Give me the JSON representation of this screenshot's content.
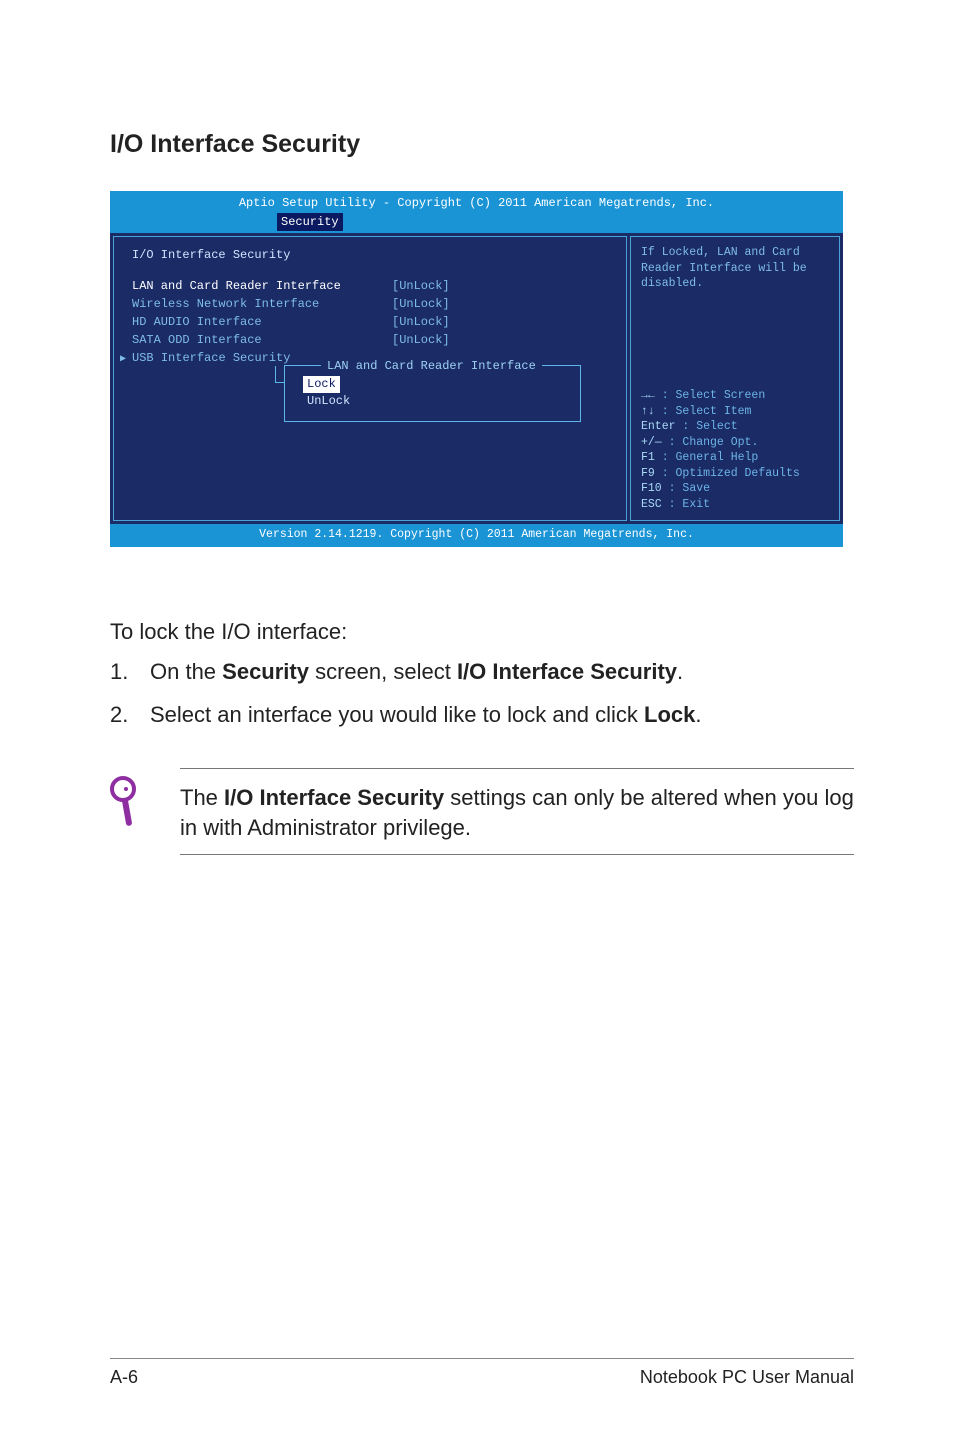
{
  "title": "I/O Interface Security",
  "bios": {
    "header": "Aptio Setup Utility - Copyright (C) 2011 American Megatrends, Inc.",
    "tab": "Security",
    "section_title": "I/O Interface Security",
    "rows": [
      {
        "label": "LAN and Card Reader Interface",
        "value": "[UnLock]",
        "highlight": true
      },
      {
        "label": "Wireless Network Interface",
        "value": "[UnLock]"
      },
      {
        "label": "HD AUDIO Interface",
        "value": "[UnLock]"
      },
      {
        "label": "SATA ODD Interface",
        "value": "[UnLock]"
      },
      {
        "label": "USB Interface Security",
        "value": "",
        "submenu": true
      }
    ],
    "popup": {
      "title": "LAN and Card Reader Interface",
      "options": [
        "Lock",
        "UnLock"
      ],
      "selected": "Lock"
    },
    "help_top": "If Locked, LAN and Card Reader Interface will be disabled.",
    "help_keys": [
      {
        "k": "→←",
        "d": ": Select Screen"
      },
      {
        "k": "↑↓",
        "d": ": Select Item"
      },
      {
        "k": "Enter",
        "d": ": Select"
      },
      {
        "k": "+/—",
        "d": ": Change Opt."
      },
      {
        "k": "F1",
        "d": ": General Help"
      },
      {
        "k": "F9",
        "d": ": Optimized Defaults"
      },
      {
        "k": "F10",
        "d": ": Save"
      },
      {
        "k": "ESC",
        "d": ": Exit"
      }
    ],
    "footer": "Version 2.14.1219. Copyright (C) 2011 American Megatrends, Inc."
  },
  "body": {
    "intro": "To lock the I/O interface:",
    "steps": [
      {
        "num": "1.",
        "pre": "On the ",
        "b1": "Security",
        "mid": " screen, select ",
        "b2": "I/O Interface Security",
        "post": "."
      },
      {
        "num": "2.",
        "pre": "Select an interface you would like to lock and click ",
        "b1": "Lock",
        "mid": "",
        "b2": "",
        "post": "."
      }
    ],
    "note_pre": "The ",
    "note_bold": "I/O Interface Security",
    "note_post": " settings can only be altered when you log in with Administrator privilege."
  },
  "footer": {
    "left": "A-6",
    "right": "Notebook PC User Manual"
  }
}
